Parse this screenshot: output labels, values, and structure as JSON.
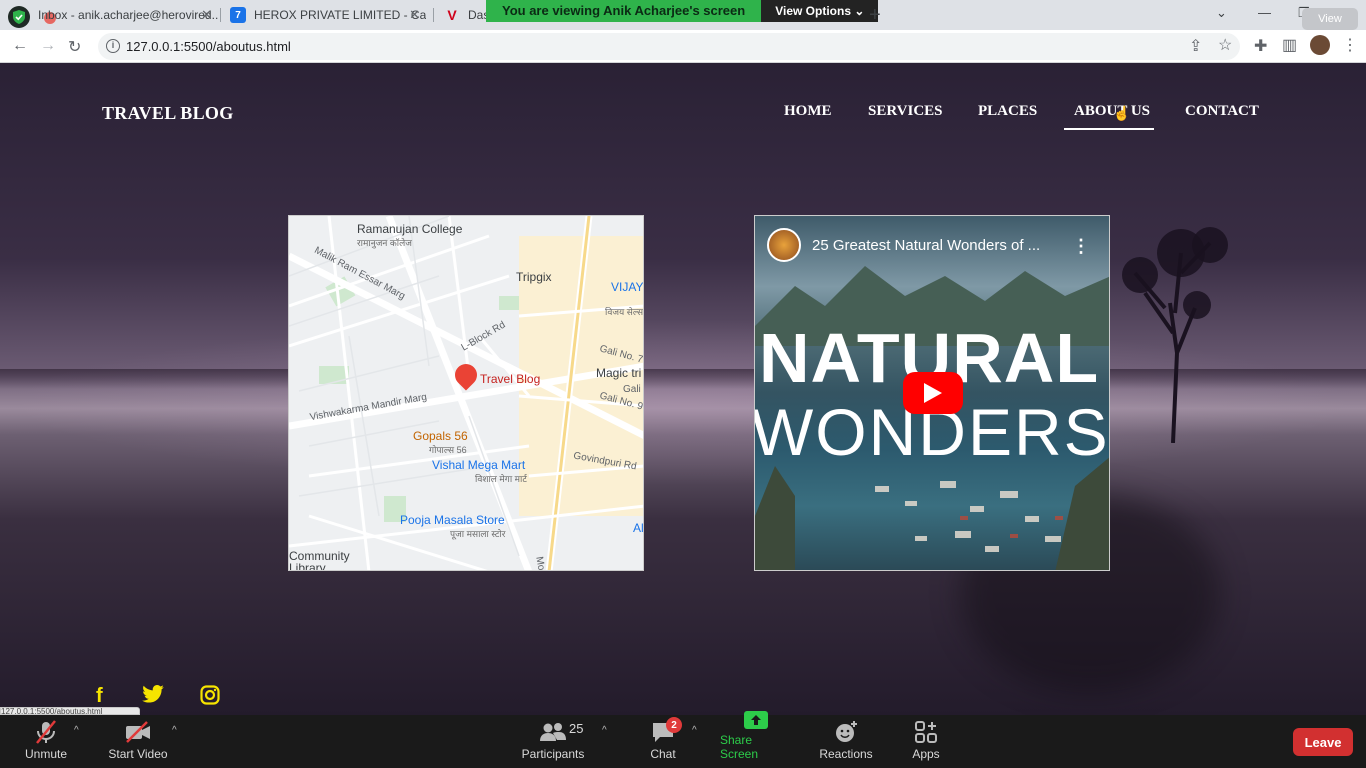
{
  "browser": {
    "tabs": [
      {
        "title": "Inbox - anik.acharjee@herovired...",
        "favicon": "gmail"
      },
      {
        "title": "HEROX PRIVATE LIMITED - Calen...",
        "favicon": "calendar"
      },
      {
        "title": "Dash",
        "favicon": "v-logo"
      }
    ],
    "url": "127.0.0.1:5500/aboutus.html",
    "status_url": "127.0.0.1:5500/aboutus.html"
  },
  "zoom_banner": {
    "viewing": "You are viewing Anik Acharjee's screen",
    "view_options": "View Options",
    "view_button": "View"
  },
  "site": {
    "brand": "TRAVEL BLOG",
    "nav": [
      {
        "label": "HOME",
        "active": false
      },
      {
        "label": "SERVICES",
        "active": false
      },
      {
        "label": "PLACES",
        "active": false
      },
      {
        "label": "ABOUT US",
        "active": true
      },
      {
        "label": "CONTACT",
        "active": false
      }
    ],
    "map": {
      "pin_label": "Travel Blog",
      "places": [
        {
          "name": "Ramanujan College",
          "sub": "रामानुजन कॉलेज"
        },
        {
          "name": "Tripgix"
        },
        {
          "name": "VIJAY S - KALKA",
          "sub": "विजय सेल्स"
        },
        {
          "name": "Magic tri"
        },
        {
          "name": "Gopals 56",
          "sub": "गोपाल्स 56"
        },
        {
          "name": "Vishal Mega Mart",
          "sub": "विशाल मेगा मार्ट"
        },
        {
          "name": "Pooja Masala Store",
          "sub": "पूजा मसाला स्टोर"
        },
        {
          "name": "Community Library"
        },
        {
          "name": "Al"
        }
      ],
      "streets": [
        "Malik Ram Essar Marg",
        "L-Block Rd",
        "Gali No. 7",
        "Gali No. 9",
        "Gali",
        "Vishwakarma Mandir Marg",
        "Govindpuri Rd",
        "Mo"
      ]
    },
    "video": {
      "title": "25 Greatest Natural Wonders of ...",
      "overlay_line1": "NATURAL",
      "overlay_line2": "WONDERS"
    },
    "social": [
      "facebook-icon",
      "twitter-icon",
      "instagram-icon"
    ],
    "colors": {
      "social": "#f6e400",
      "nav_text": "#ffffff"
    }
  },
  "zoom_bar": {
    "unmute": "Unmute",
    "start_video": "Start Video",
    "participants": "Participants",
    "participants_count": "25",
    "chat": "Chat",
    "chat_badge": "2",
    "share_screen": "Share Screen",
    "reactions": "Reactions",
    "apps": "Apps",
    "leave": "Leave",
    "colors": {
      "share": "#2dcc4a",
      "leave": "#d23030"
    }
  }
}
